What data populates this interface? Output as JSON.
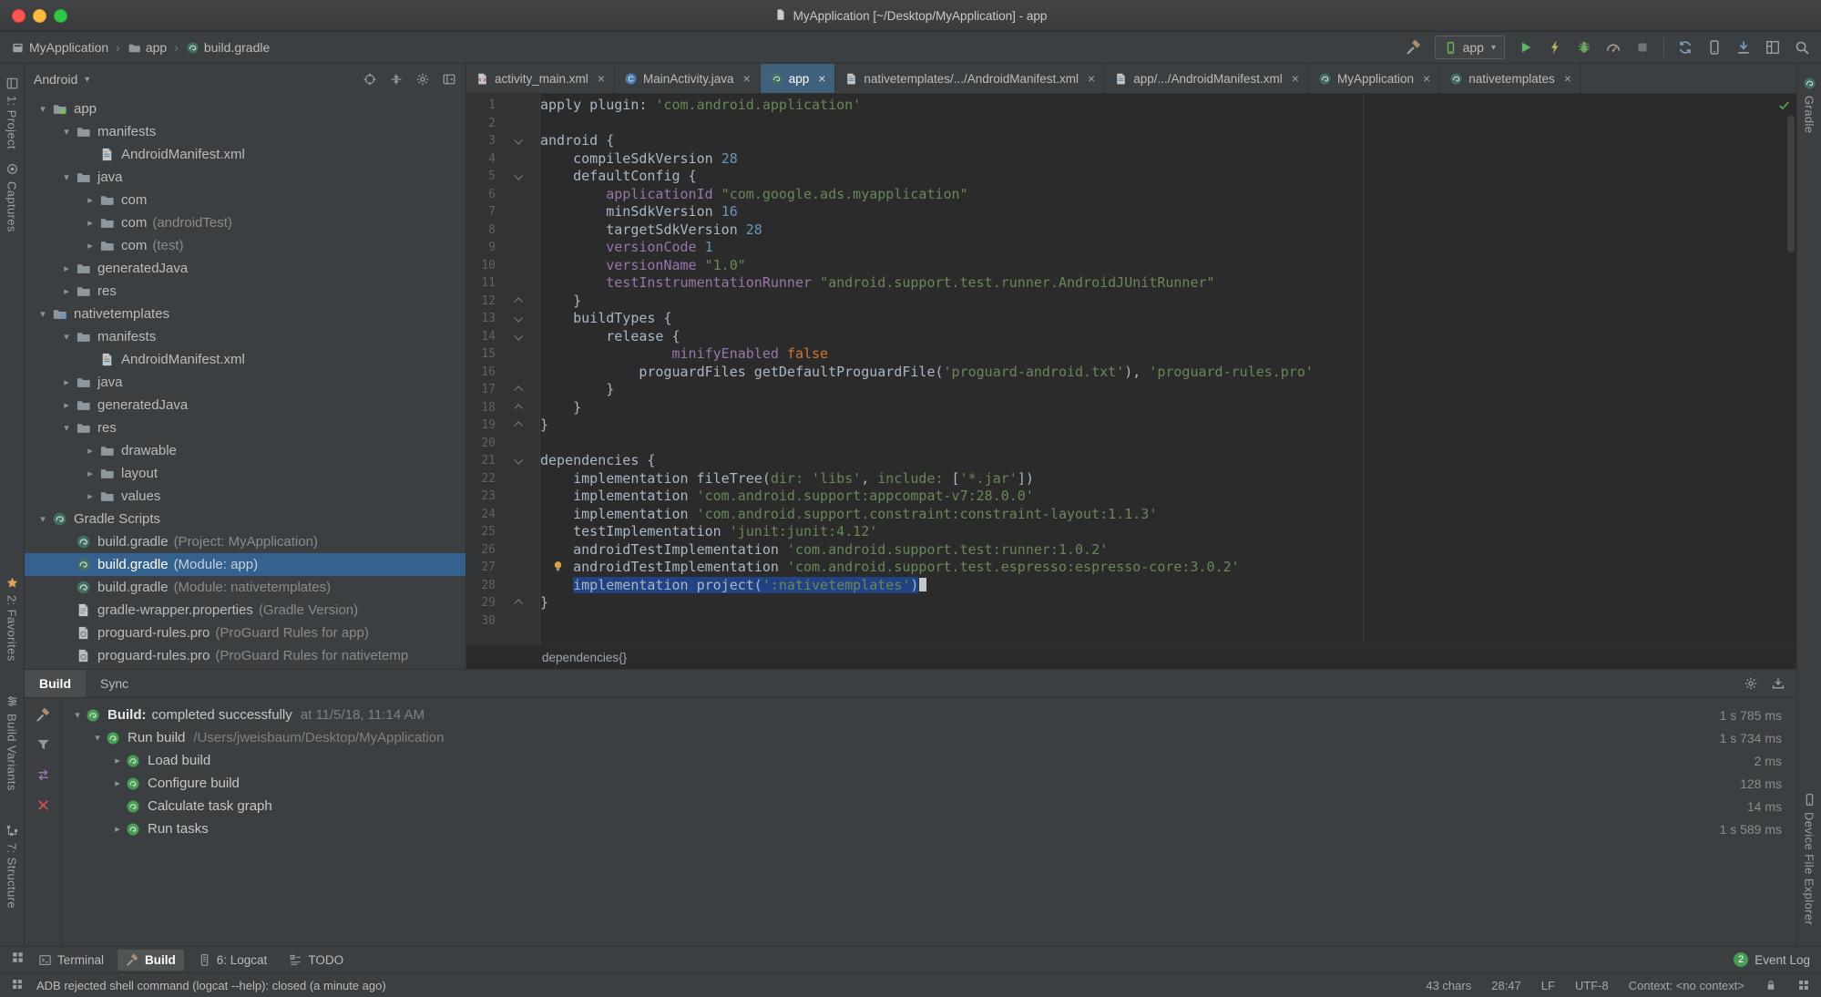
{
  "titlebar": {
    "title": "MyApplication [~/Desktop/MyApplication] - app"
  },
  "navbar": {
    "breadcrumbs": [
      {
        "label": "MyApplication",
        "icon": "window"
      },
      {
        "label": "app",
        "icon": "folder"
      },
      {
        "label": "build.gradle",
        "icon": "gradle"
      }
    ],
    "toolbar": {
      "run_config": {
        "label": "app",
        "icon": "device-green"
      },
      "actions": [
        {
          "name": "run",
          "icon": "play"
        },
        {
          "name": "apply-changes",
          "icon": "lightning"
        },
        {
          "name": "debug",
          "icon": "bug"
        },
        {
          "name": "profiler",
          "icon": "gauge"
        },
        {
          "name": "stop",
          "icon": "stop"
        },
        {
          "name": "divider"
        },
        {
          "name": "sync-gradle",
          "icon": "sync"
        },
        {
          "name": "avd-manager",
          "icon": "phone"
        },
        {
          "name": "sdk-manager",
          "icon": "download"
        },
        {
          "name": "layout-inspector",
          "icon": "layout"
        },
        {
          "name": "search-everywhere",
          "icon": "search"
        }
      ]
    }
  },
  "left_stripe": {
    "top": [
      {
        "label": "1: Project",
        "icon": "project"
      },
      {
        "label": "Captures",
        "icon": "captures"
      }
    ],
    "bottom": [
      {
        "label": "2: Favorites",
        "icon": "star"
      },
      {
        "label": "Build Variants",
        "icon": "variants"
      },
      {
        "label": "7: Structure",
        "icon": "structure"
      }
    ]
  },
  "right_stripe": {
    "top": [
      {
        "label": "Gradle",
        "icon": "gradle"
      }
    ],
    "bottom": [
      {
        "label": "Device File Explorer",
        "icon": "phone"
      }
    ]
  },
  "project_panel": {
    "view_selector": "Android",
    "header_icons": [
      "crosshair",
      "collapse",
      "gear",
      "hide"
    ],
    "tree": [
      {
        "depth": 0,
        "ch": "open",
        "icon": "module-app",
        "label": "app"
      },
      {
        "depth": 1,
        "ch": "open",
        "icon": "folder",
        "label": "manifests"
      },
      {
        "depth": 2,
        "ch": "none",
        "icon": "file-manifest",
        "label": "AndroidManifest.xml"
      },
      {
        "depth": 1,
        "ch": "open",
        "icon": "folder",
        "label": "java"
      },
      {
        "depth": 2,
        "ch": "closed",
        "icon": "folder",
        "label": "com"
      },
      {
        "depth": 2,
        "ch": "closed",
        "icon": "folder",
        "label": "com",
        "note": "(androidTest)"
      },
      {
        "depth": 2,
        "ch": "closed",
        "icon": "folder",
        "label": "com",
        "note": "(test)"
      },
      {
        "depth": 1,
        "ch": "closed",
        "icon": "folder",
        "label": "generatedJava"
      },
      {
        "depth": 1,
        "ch": "closed",
        "icon": "folder",
        "label": "res"
      },
      {
        "depth": 0,
        "ch": "open",
        "icon": "module-lib",
        "label": "nativetemplates"
      },
      {
        "depth": 1,
        "ch": "open",
        "icon": "folder",
        "label": "manifests"
      },
      {
        "depth": 2,
        "ch": "none",
        "icon": "file-manifest",
        "label": "AndroidManifest.xml"
      },
      {
        "depth": 1,
        "ch": "closed",
        "icon": "folder",
        "label": "java"
      },
      {
        "depth": 1,
        "ch": "closed",
        "icon": "folder",
        "label": "generatedJava"
      },
      {
        "depth": 1,
        "ch": "open",
        "icon": "folder",
        "label": "res"
      },
      {
        "depth": 2,
        "ch": "closed",
        "icon": "folder",
        "label": "drawable"
      },
      {
        "depth": 2,
        "ch": "closed",
        "icon": "folder",
        "label": "layout"
      },
      {
        "depth": 2,
        "ch": "closed",
        "icon": "folder",
        "label": "values"
      },
      {
        "depth": 0,
        "ch": "open",
        "icon": "gradle",
        "label": "Gradle Scripts"
      },
      {
        "depth": 1,
        "ch": "none",
        "icon": "gradle",
        "label": "build.gradle",
        "note": "(Project: MyApplication)"
      },
      {
        "depth": 1,
        "ch": "none",
        "icon": "gradle",
        "label": "build.gradle",
        "note": "(Module: app)",
        "selected": true
      },
      {
        "depth": 1,
        "ch": "none",
        "icon": "gradle",
        "label": "build.gradle",
        "note": "(Module: nativetemplates)"
      },
      {
        "depth": 1,
        "ch": "none",
        "icon": "file-props",
        "label": "gradle-wrapper.properties",
        "note": "(Gradle Version)"
      },
      {
        "depth": 1,
        "ch": "none",
        "icon": "file-pro",
        "label": "proguard-rules.pro",
        "note": "(ProGuard Rules for app)"
      },
      {
        "depth": 1,
        "ch": "none",
        "icon": "file-pro",
        "label": "proguard-rules.pro",
        "note": "(ProGuard Rules for nativetemp"
      }
    ]
  },
  "editor": {
    "tabs": [
      {
        "label": "activity_main.xml",
        "icon": "file-xml"
      },
      {
        "label": "MainActivity.java",
        "icon": "class-c"
      },
      {
        "label": "app",
        "icon": "gradle",
        "active": true
      },
      {
        "label": "nativetemplates/.../AndroidManifest.xml",
        "icon": "file-manifest"
      },
      {
        "label": "app/.../AndroidManifest.xml",
        "icon": "file-manifest"
      },
      {
        "label": "MyApplication",
        "icon": "gradle"
      },
      {
        "label": "nativetemplates",
        "icon": "gradle"
      }
    ],
    "breadcrumb": "dependencies{}",
    "lines": [
      {
        "n": 1,
        "t": [
          [
            "apply plugin: ",
            "d"
          ],
          [
            "'com.android.application'",
            "s"
          ]
        ]
      },
      {
        "n": 2,
        "t": []
      },
      {
        "n": 3,
        "fold": "open",
        "t": [
          [
            "android {",
            "d"
          ]
        ]
      },
      {
        "n": 4,
        "t": [
          [
            "    compileSdkVersion ",
            "d"
          ],
          [
            "28",
            "n"
          ]
        ]
      },
      {
        "n": 5,
        "fold": "open",
        "t": [
          [
            "    defaultConfig {",
            "d"
          ]
        ]
      },
      {
        "n": 6,
        "t": [
          [
            "        ",
            "d"
          ],
          [
            "applicationId",
            "m"
          ],
          [
            " ",
            "d"
          ],
          [
            "\"com.google.ads.myapplication\"",
            "s"
          ]
        ]
      },
      {
        "n": 7,
        "t": [
          [
            "        minSdkVersion ",
            "d"
          ],
          [
            "16",
            "n"
          ]
        ]
      },
      {
        "n": 8,
        "t": [
          [
            "        targetSdkVersion ",
            "d"
          ],
          [
            "28",
            "n"
          ]
        ]
      },
      {
        "n": 9,
        "t": [
          [
            "        ",
            "d"
          ],
          [
            "versionCode",
            "m"
          ],
          [
            " ",
            "d"
          ],
          [
            "1",
            "n"
          ]
        ]
      },
      {
        "n": 10,
        "t": [
          [
            "        ",
            "d"
          ],
          [
            "versionName",
            "m"
          ],
          [
            " ",
            "d"
          ],
          [
            "\"1.0\"",
            "s"
          ]
        ]
      },
      {
        "n": 11,
        "t": [
          [
            "        ",
            "d"
          ],
          [
            "testInstrumentationRunner",
            "m"
          ],
          [
            " ",
            "d"
          ],
          [
            "\"android.support.test.runner.AndroidJUnitRunner\"",
            "s"
          ]
        ]
      },
      {
        "n": 12,
        "fold": "close",
        "t": [
          [
            "    }",
            "d"
          ]
        ]
      },
      {
        "n": 13,
        "fold": "open",
        "t": [
          [
            "    buildTypes {",
            "d"
          ]
        ]
      },
      {
        "n": 14,
        "fold": "open",
        "t": [
          [
            "        release {",
            "d"
          ]
        ]
      },
      {
        "n": 15,
        "t": [
          [
            "                ",
            "d"
          ],
          [
            "minifyEnabled",
            "m"
          ],
          [
            " ",
            "d"
          ],
          [
            "false",
            "k"
          ]
        ]
      },
      {
        "n": 16,
        "t": [
          [
            "            proguardFiles getDefaultProguardFile(",
            "d"
          ],
          [
            "'proguard-android.txt'",
            "s"
          ],
          [
            "), ",
            "d"
          ],
          [
            "'proguard-rules.pro'",
            "s"
          ]
        ]
      },
      {
        "n": 17,
        "fold": "close",
        "t": [
          [
            "        }",
            "d"
          ]
        ]
      },
      {
        "n": 18,
        "fold": "close",
        "t": [
          [
            "    }",
            "d"
          ]
        ]
      },
      {
        "n": 19,
        "fold": "close",
        "t": [
          [
            "}",
            "d"
          ]
        ]
      },
      {
        "n": 20,
        "t": []
      },
      {
        "n": 21,
        "fold": "open",
        "t": [
          [
            "dependencies {",
            "d"
          ]
        ]
      },
      {
        "n": 22,
        "t": [
          [
            "    implementation fileTree(",
            "d"
          ],
          [
            "dir:",
            "na"
          ],
          [
            " ",
            "d"
          ],
          [
            "'libs'",
            "s"
          ],
          [
            ", ",
            "d"
          ],
          [
            "include:",
            "na"
          ],
          [
            " [",
            "d"
          ],
          [
            "'*.jar'",
            "s"
          ],
          [
            "])",
            "d"
          ]
        ]
      },
      {
        "n": 23,
        "t": [
          [
            "    implementation ",
            "d"
          ],
          [
            "'com.android.support:appcompat-v7:28.0.0'",
            "s"
          ]
        ]
      },
      {
        "n": 24,
        "t": [
          [
            "    implementation ",
            "d"
          ],
          [
            "'com.android.support.constraint:constraint-layout:1.1.3'",
            "s"
          ]
        ]
      },
      {
        "n": 25,
        "t": [
          [
            "    testImplementation ",
            "d"
          ],
          [
            "'junit:junit:4.12'",
            "s"
          ]
        ]
      },
      {
        "n": 26,
        "t": [
          [
            "    androidTestImplementation ",
            "d"
          ],
          [
            "'com.android.support.test:runner:1.0.2'",
            "s"
          ]
        ]
      },
      {
        "n": 27,
        "bulb": true,
        "t": [
          [
            "    androidTestImplementation ",
            "d"
          ],
          [
            "'com.android.support.test.espresso:espresso-core:3.0.2'",
            "s"
          ]
        ]
      },
      {
        "n": 28,
        "sel": true,
        "t": [
          [
            "    ",
            "d"
          ],
          [
            "implementation project(",
            "d"
          ],
          [
            "':nativetemplates'",
            "s"
          ],
          [
            ")",
            "d"
          ]
        ]
      },
      {
        "n": 29,
        "fold": "close",
        "t": [
          [
            "}",
            "d"
          ]
        ]
      },
      {
        "n": 30,
        "t": []
      }
    ]
  },
  "build_panel": {
    "tabs": [
      {
        "label": "Build",
        "active": true
      },
      {
        "label": "Sync",
        "active": false
      }
    ],
    "header_icons": [
      "gear",
      "import"
    ],
    "toolbar_icons": [
      "hammer",
      "funnel",
      "swap",
      "close-red"
    ],
    "rows": [
      {
        "depth": 0,
        "ch": "open",
        "title": "Build:",
        "text": "completed successfully",
        "meta": "at 11/5/18, 11:14 AM",
        "dur": "1 s 785 ms"
      },
      {
        "depth": 1,
        "ch": "open",
        "text": "Run build",
        "meta": "/Users/jweisbaum/Desktop/MyApplication",
        "dur": "1 s 734 ms"
      },
      {
        "depth": 2,
        "ch": "closed",
        "text": "Load build",
        "dur": "2 ms"
      },
      {
        "depth": 2,
        "ch": "closed",
        "text": "Configure build",
        "dur": "128 ms"
      },
      {
        "depth": 2,
        "ch": "none",
        "text": "Calculate task graph",
        "dur": "14 ms"
      },
      {
        "depth": 2,
        "ch": "closed",
        "text": "Run tasks",
        "dur": "1 s 589 ms"
      }
    ]
  },
  "bottom_bar": {
    "items": [
      {
        "label": "Terminal",
        "icon": "terminal",
        "active": false
      },
      {
        "label": "Build",
        "icon": "hammer",
        "active": true
      },
      {
        "label": "6: Logcat",
        "icon": "logcat",
        "active": false
      },
      {
        "label": "TODO",
        "icon": "todo",
        "active": false
      }
    ],
    "event_log": {
      "badge": "2",
      "label": "Event Log"
    }
  },
  "status_bar": {
    "message": "ADB rejected shell command (logcat --help): closed (a minute ago)",
    "widgets": [
      "43 chars",
      "28:47",
      "LF",
      "UTF-8",
      "Context: <no context>"
    ],
    "icons": [
      "lock",
      "grid"
    ]
  }
}
